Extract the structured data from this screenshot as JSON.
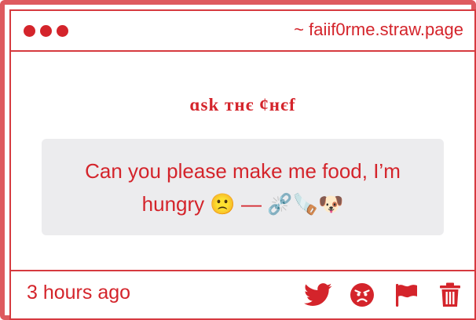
{
  "window": {
    "url": "~ faiif0rme.straw.page"
  },
  "main": {
    "heading": "ɑsk ᴛʜє ¢ʜєf",
    "question": "Can you please make me food, I’m hungry 🙁 — ⛓️‍💥🪚🐶"
  },
  "footer": {
    "timestamp": "3 hours ago",
    "icons": [
      "twitter-icon",
      "angry-face-icon",
      "flag-icon",
      "trash-icon"
    ]
  },
  "colors": {
    "accent": "#d4242b",
    "border": "#de5a5f",
    "question_bg": "#ececee"
  }
}
